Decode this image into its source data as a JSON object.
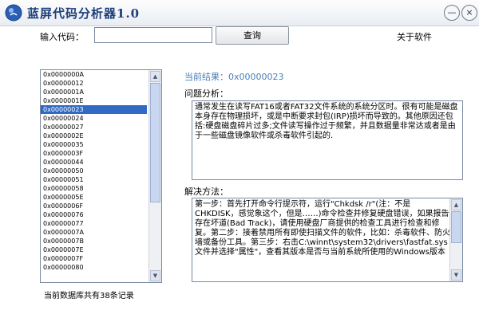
{
  "window": {
    "title": "蓝屏代码分析器1.0",
    "minimize_glyph": "—",
    "close_glyph": "×"
  },
  "toolbar": {
    "input_label": "输入代码：",
    "input_value": "",
    "query_label": "查询",
    "about_label": "关于软件"
  },
  "list": {
    "items": [
      "0x0000000A",
      "0x00000012",
      "0x0000001A",
      "0x0000001E",
      "0x00000023",
      "0x00000024",
      "0x00000027",
      "0x0000002E",
      "0x00000035",
      "0x0000003F",
      "0x00000044",
      "0x00000050",
      "0x00000051",
      "0x00000058",
      "0x0000005E",
      "0x0000006F",
      "0x00000076",
      "0x00000077",
      "0x0000007A",
      "0x0000007B",
      "0x0000007E",
      "0x0000007F",
      "0x00000080"
    ],
    "selected_index": 4
  },
  "details": {
    "current_result": "当前结果：0x00000023",
    "problem_label": "问题分析：",
    "problem_text": "通常发生在读写FAT16或者FAT32文件系统的系统分区时。很有可能是磁盘本身存在物理损坏，或是中断要求封包(IRP)损坏而导致的。其他原因还包括:硬盘磁盘碎片过多;文件读写操作过于频繁，并且数据量非常达或者是由于一些磁盘镜像软件或杀毒软件引起的.",
    "solution_label": "解决方法：",
    "solution_text": "第一步：首先打开命令行提示符，运行\"Chkdsk /r\"(注：不是CHKDISK，感觉象这个，但是……)命令检查并修复硬盘错误，如果报告存在坏道(Bad Track)，请使用硬盘厂商提供的检查工具进行检查和修复。第二步：接着禁用所有即使扫描文件的软件，比如：杀毒软件、防火墙或备份工具。第三步：右击C:\\winnt\\system32\\drivers\\fastfat.sys文件并选择\"属性\"，查看其版本是否与当前系统所使用的Windows版本"
  },
  "footer": {
    "record_count": "当前数据库共有38条记录"
  },
  "icons": {
    "app": "blue-circle-app-icon",
    "scroll_up": "▲",
    "scroll_down": "▼"
  },
  "colors": {
    "title_text": "#1e3f7a",
    "selection": "#316ac5",
    "result_text": "#4a7fb5"
  }
}
